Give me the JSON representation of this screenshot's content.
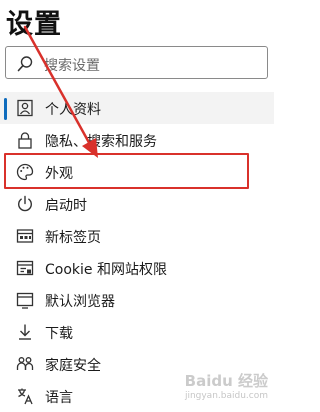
{
  "page_title": "设置",
  "search": {
    "placeholder": "搜索设置"
  },
  "nav": {
    "items": [
      {
        "label": "个人资料",
        "icon": "profile-icon",
        "selected": true
      },
      {
        "label": "隐私、搜索和服务",
        "icon": "lock-icon"
      },
      {
        "label": "外观",
        "icon": "palette-icon"
      },
      {
        "label": "启动时",
        "icon": "power-icon"
      },
      {
        "label": "新标签页",
        "icon": "new-tab-icon"
      },
      {
        "label": "Cookie 和网站权限",
        "icon": "site-permissions-icon"
      },
      {
        "label": "默认浏览器",
        "icon": "browser-icon"
      },
      {
        "label": "下载",
        "icon": "download-icon"
      },
      {
        "label": "家庭安全",
        "icon": "family-icon"
      },
      {
        "label": "语言",
        "icon": "language-icon"
      }
    ]
  },
  "annotation": {
    "highlight_color": "#d9312b",
    "accent_color": "#0f6cbd"
  },
  "watermark": {
    "text": "Baidu 经验",
    "sub": "jingyan.baidu.com"
  }
}
